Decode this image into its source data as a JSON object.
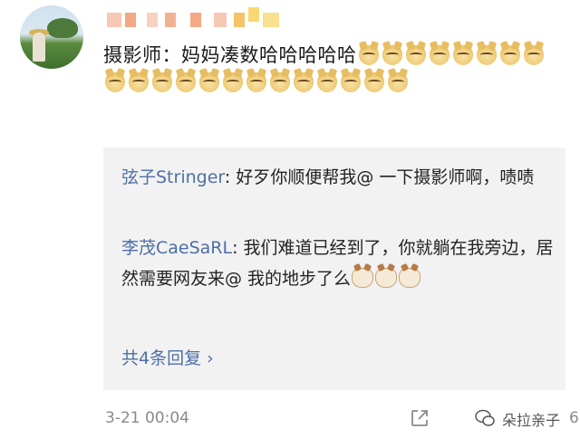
{
  "post": {
    "text": "摄影师：妈妈凑数哈哈哈哈哈"
  },
  "emoji": {
    "post_trailing": "doge",
    "post_trailing_count": 21,
    "reply_trailing": "cat",
    "reply_trailing_count": 3
  },
  "replies": [
    {
      "author": "弦子Stringer",
      "text": ": 好歹你顺便帮我@ 一下摄影师啊，啧啧"
    },
    {
      "author": "李茂CaeSaRL",
      "text": ": 我们难道已经到了，你就躺在我旁边，居然需要网友来@ 我的地步了么"
    }
  ],
  "reply_count_label": "共4条回复 ›",
  "timestamp": "3-21 00:04",
  "watermark": "朵拉亲子",
  "like_count": "6",
  "colors": {
    "link": "#4e6fa6",
    "reply_bg": "#f2f2f2",
    "meta_text": "#8a8a8a"
  }
}
